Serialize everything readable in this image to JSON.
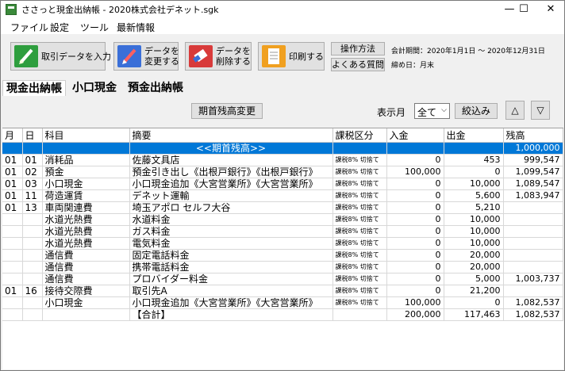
{
  "window": {
    "title": "ささっと現金出納帳 - 2020株式会社デネット.sgk",
    "minimize": "—",
    "maximize": "☐",
    "close": "✕"
  },
  "menu": [
    "ファイル",
    "設定",
    "ツール",
    "最新情報"
  ],
  "toolbar": {
    "input_label": "取引データを入力",
    "edit_label_1": "データを",
    "edit_label_2": "変更する",
    "delete_label_1": "データを",
    "delete_label_2": "削除する",
    "print_label": "印刷する",
    "howto_label": "操作方法",
    "faq_label": "よくある質問",
    "period": "会計期間：2020年1月1日 ～ 2020年12月31日",
    "closing": "締め日：月末"
  },
  "tabs": [
    "現金出納帳",
    "小口現金",
    "預金出納帳"
  ],
  "filter": {
    "opening_button": "期首残高変更",
    "month_label": "表示月",
    "month_value": "全て",
    "narrow_button": "絞込み",
    "up": "△",
    "down": "▽"
  },
  "columns": [
    "月",
    "日",
    "科目",
    "摘要",
    "課税区分",
    "入金",
    "出金",
    "残高"
  ],
  "rows": [
    {
      "m": "",
      "d": "",
      "account": "",
      "desc": "<<期首残高>>",
      "tax": "",
      "in": "",
      "out": "",
      "bal": "1,000,000",
      "selected": true
    },
    {
      "m": "01",
      "d": "01",
      "account": "消耗品",
      "desc": "佐藤文具店",
      "tax": "課税8% 切捨て",
      "in": "0",
      "out": "453",
      "bal": "999,547"
    },
    {
      "m": "01",
      "d": "02",
      "account": "預金",
      "desc": "預金引き出し《出根戸銀行》《出根戸銀行》",
      "tax": "課税8% 切捨て",
      "in": "100,000",
      "out": "0",
      "bal": "1,099,547"
    },
    {
      "m": "01",
      "d": "03",
      "account": "小口現金",
      "desc": "小口現金追加《大宮営業所》《大宮営業所》",
      "tax": "課税8% 切捨て",
      "in": "0",
      "out": "10,000",
      "bal": "1,089,547"
    },
    {
      "m": "01",
      "d": "11",
      "account": "荷造運賃",
      "desc": "デネット運輸",
      "tax": "課税8% 切捨て",
      "in": "0",
      "out": "5,600",
      "bal": "1,083,947"
    },
    {
      "m": "01",
      "d": "13",
      "account": "車両関連費",
      "desc": "埼玉アポロ セルフ大谷",
      "tax": "課税8% 切捨て",
      "in": "0",
      "out": "5,210",
      "bal": ""
    },
    {
      "m": "",
      "d": "",
      "account": "水道光熱費",
      "desc": "水道料金",
      "tax": "課税8% 切捨て",
      "in": "0",
      "out": "10,000",
      "bal": ""
    },
    {
      "m": "",
      "d": "",
      "account": "水道光熱費",
      "desc": "ガス料金",
      "tax": "課税8% 切捨て",
      "in": "0",
      "out": "10,000",
      "bal": ""
    },
    {
      "m": "",
      "d": "",
      "account": "水道光熱費",
      "desc": "電気料金",
      "tax": "課税8% 切捨て",
      "in": "0",
      "out": "10,000",
      "bal": ""
    },
    {
      "m": "",
      "d": "",
      "account": "通信費",
      "desc": "固定電話料金",
      "tax": "課税8% 切捨て",
      "in": "0",
      "out": "20,000",
      "bal": ""
    },
    {
      "m": "",
      "d": "",
      "account": "通信費",
      "desc": "携帯電話料金",
      "tax": "課税8% 切捨て",
      "in": "0",
      "out": "20,000",
      "bal": ""
    },
    {
      "m": "",
      "d": "",
      "account": "通信費",
      "desc": "プロバイダー料金",
      "tax": "課税8% 切捨て",
      "in": "0",
      "out": "5,000",
      "bal": "1,003,737"
    },
    {
      "m": "01",
      "d": "16",
      "account": "接待交際費",
      "desc": "取引先A",
      "tax": "課税8% 切捨て",
      "in": "0",
      "out": "21,200",
      "bal": ""
    },
    {
      "m": "",
      "d": "",
      "account": "小口現金",
      "desc": "小口現金追加《大宮営業所》《大宮営業所》",
      "tax": "課税8% 切捨て",
      "in": "100,000",
      "out": "0",
      "bal": "1,082,537"
    },
    {
      "m": "",
      "d": "",
      "account": "",
      "desc": "【合計】",
      "tax": "",
      "in": "200,000",
      "out": "117,463",
      "bal": "1,082,537"
    }
  ],
  "colors": {
    "selection": "#0078d7",
    "input_icon": "#2e9e3e",
    "edit_icon": "#3a6fd8",
    "delete_icon": "#d83a3a",
    "print_icon": "#f0a020"
  }
}
